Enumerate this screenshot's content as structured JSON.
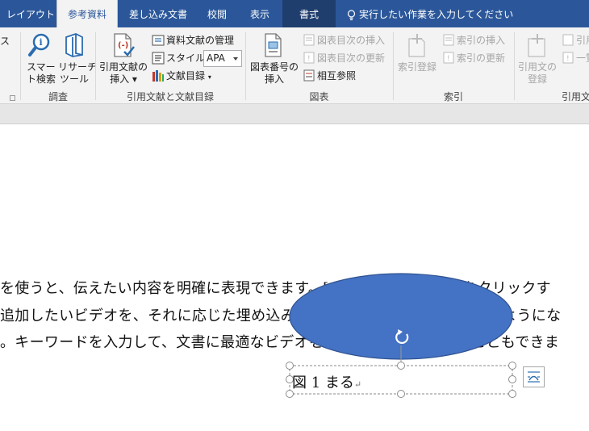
{
  "tabs": {
    "layout": "レイアウト",
    "references": "参考資料",
    "mailings": "差し込み文書",
    "review": "校閲",
    "view": "表示",
    "format": "書式",
    "tell_me": "実行したい作業を入力してください"
  },
  "ribbon": {
    "partial_left": "ス",
    "research": {
      "smart_lookup": [
        "スマー",
        "ト検索"
      ],
      "researcher": [
        "リサーチ",
        "ツール"
      ],
      "group": "調査"
    },
    "citations": {
      "insert_citation": [
        "引用文献の",
        "挿入 ▾"
      ],
      "manage_sources": "資料文献の管理",
      "style_label": "スタイル:",
      "style_value": "APA",
      "bibliography": "文献目録",
      "group": "引用文献と文献目録"
    },
    "captions": {
      "insert_caption": [
        "図表番号の",
        "挿入"
      ],
      "insert_table_of_figures": "図表目次の挿入",
      "update_table": "図表目次の更新",
      "cross_reference": "相互参照",
      "group": "図表"
    },
    "index": {
      "mark_entry": "索引登録",
      "insert_index": "索引の挿入",
      "update_index": "索引の更新",
      "group": "索引"
    },
    "toa": {
      "mark_citation": [
        "引用文の",
        "登録"
      ],
      "insert_toa": "引用",
      "update_toa": "一覧",
      "group": "引用文"
    }
  },
  "document": {
    "lines": [
      "を使うと、伝えたい内容を明確に表現できます。[オンライン ビデオ] をクリックす",
      "追加したいビデオを、それに応じた埋め込みコードの形式で貼り付けられるようにな",
      "。キーワードを入力して、文書に最適なビデオをオンラインで検索することもできま"
    ],
    "caption": "図 1 まる"
  },
  "colors": {
    "title_bar": "#2b579a",
    "format_tab": "#1f3e6e",
    "shape_fill": "#4472c4",
    "shape_stroke": "#2f528f"
  }
}
